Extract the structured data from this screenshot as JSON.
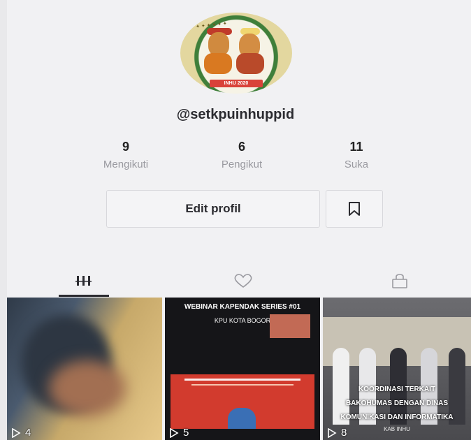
{
  "profile": {
    "username": "@setkpuinhuppid",
    "avatar_label": "INHU 2020"
  },
  "stats": [
    {
      "value": "9",
      "label": "Mengikuti"
    },
    {
      "value": "6",
      "label": "Pengikut"
    },
    {
      "value": "11",
      "label": "Suka"
    }
  ],
  "actions": {
    "edit_label": "Edit profil",
    "bookmark_icon": "bookmark-icon"
  },
  "tabs": [
    {
      "icon": "grid-icon",
      "active": true
    },
    {
      "icon": "heart-icon",
      "active": false
    },
    {
      "icon": "lock-icon",
      "active": false
    }
  ],
  "videos": [
    {
      "views": "4"
    },
    {
      "views": "5",
      "title": "WEBINAR KAPENDAK SERIES #01",
      "subtitle": "KPU KOTA BOGOR"
    },
    {
      "views": "8",
      "caption1": "KOORDINASI TERKAIT",
      "caption2": "BAKOHUMAS DENGAN DINAS",
      "caption3": "KOMUNIKASI DAN INFORMATIKA",
      "caption4": "KAB INHU"
    }
  ]
}
